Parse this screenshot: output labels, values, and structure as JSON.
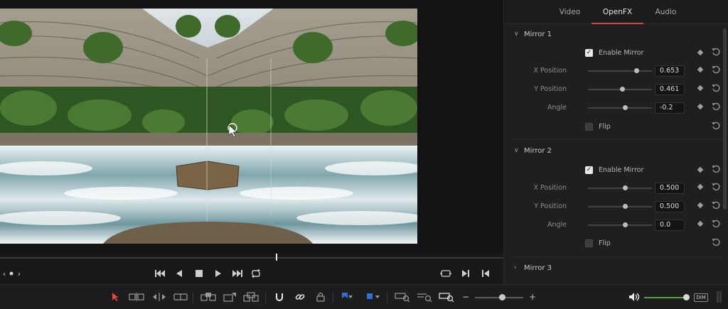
{
  "inspector": {
    "tabs": [
      {
        "label": "Video",
        "active": false
      },
      {
        "label": "OpenFX",
        "active": true
      },
      {
        "label": "Audio",
        "active": false
      }
    ],
    "sections": [
      {
        "title": "Mirror 1",
        "expanded": true,
        "enable_label": "Enable Mirror",
        "enabled": true,
        "params": [
          {
            "label": "X Position",
            "value": "0.653",
            "level": 0.75
          },
          {
            "label": "Y Position",
            "value": "0.461",
            "level": 0.53
          },
          {
            "label": "Angle",
            "value": "-0.2",
            "level": 0.58
          }
        ],
        "flip_label": "Flip",
        "flip": false
      },
      {
        "title": "Mirror 2",
        "expanded": true,
        "enable_label": "Enable Mirror",
        "enabled": true,
        "params": [
          {
            "label": "X Position",
            "value": "0.500",
            "level": 0.58
          },
          {
            "label": "Y Position",
            "value": "0.500",
            "level": 0.58
          },
          {
            "label": "Angle",
            "value": "0.0",
            "level": 0.58
          }
        ],
        "flip_label": "Flip",
        "flip": false
      },
      {
        "title": "Mirror 3",
        "expanded": false
      }
    ]
  },
  "colors": {
    "accent_tab": "#d24a3b",
    "playhead": "#e8e8e8",
    "volume": "#5aa33a",
    "flag_blue": "#2f6fd6",
    "pointer_red": "#e04a35"
  },
  "toolbar": {
    "dim_label": "DIM",
    "zoom_out": "−",
    "zoom_in": "+"
  },
  "transport": {
    "nav_prev": "‹",
    "nav_next": "›"
  }
}
